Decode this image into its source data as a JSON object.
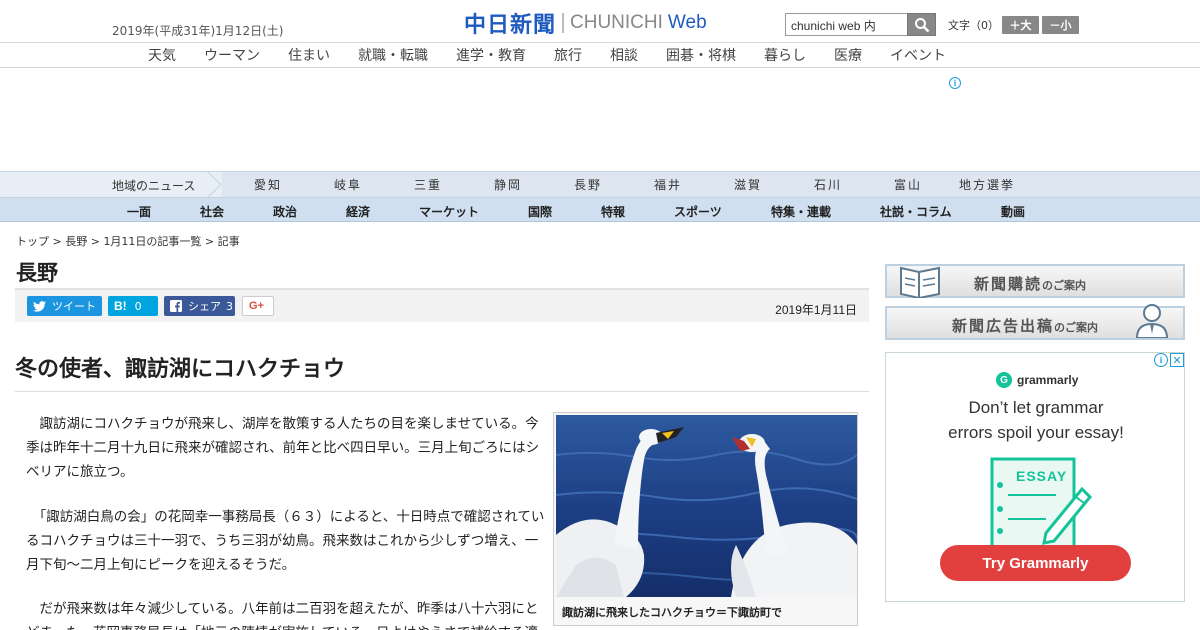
{
  "header": {
    "date": "2019年(平成31年)1月12日(土)",
    "logo_kanji": "中日新聞",
    "logo_en": "CHUNICHI",
    "logo_web": "Web",
    "search_value": "chunichi web 内",
    "fontsize_label": "文字（0）",
    "font_larger": "＋大",
    "font_smaller": "－小"
  },
  "top_nav": [
    "天気",
    "ウーマン",
    "住まい",
    "就職・転職",
    "進学・教育",
    "旅行",
    "相談",
    "囲碁・将棋",
    "暮らし",
    "医療",
    "イベント"
  ],
  "regional": {
    "title": "地域のニュース",
    "items": [
      "愛知",
      "岐阜",
      "三重",
      "静岡",
      "長野",
      "福井",
      "滋賀",
      "石川",
      "富山",
      "地方選挙"
    ]
  },
  "main_nav": [
    "一面",
    "社会",
    "政治",
    "経済",
    "マーケット",
    "国際",
    "特報",
    "スポーツ",
    "特集・連載",
    "社説・コラム",
    "動画"
  ],
  "breadcrumb": {
    "top": "トップ",
    "region": "長野",
    "list": "1月11日の記事一覧",
    "current": "記事",
    "sep": " > "
  },
  "section_title": "長野",
  "share": {
    "tweet": "ツイート",
    "hatena_count": "0",
    "facebook_label": "シェア",
    "facebook_count": "3",
    "gplus": "G+"
  },
  "article": {
    "date": "2019年1月11日",
    "headline": "冬の使者、諏訪湖にコハクチョウ",
    "paragraphs": [
      "　諏訪湖にコハクチョウが飛来し、湖岸を散策する人たちの目を楽しませている。今季は昨年十二月十九日に飛来が確認され、前年と比べ四日早い。三月上旬ごろにはシベリアに旅立つ。",
      "　「諏訪湖白鳥の会」の花岡幸一事務局長（６３）によると、十日時点で確認されているコハクチョウは三十一羽で、うち三羽が幼鳥。飛来数はこれから少しずつ増え、一月下旬～二月上旬にピークを迎えるそうだ。",
      "　だが飛来数は年々減少している。八年前は二百羽を超えたが、昨季は八十六羽にとどまった。花岡事務局長は「地元の陳情が実施している、日よけやえさで補給する適"
    ],
    "photo_caption": "諏訪湖に飛来したコハクチョウ＝下諏訪町で"
  },
  "sidebar": {
    "subscribe_main": "新聞購読",
    "subscribe_sub": "のご案内",
    "ad_main": "新聞広告出稿",
    "ad_sub": "のご案内"
  },
  "grammarly_ad": {
    "brand": "grammarly",
    "text_line1": "Don’t let grammar",
    "text_line2": "errors spoil your essay!",
    "essay_label": "ESSAY",
    "cta": "Try Grammarly"
  },
  "colors": {
    "brand_blue": "#1f5bbf",
    "twitter": "#1b95e0",
    "hatena": "#00a4de",
    "facebook": "#3b5998",
    "gplus": "#dd4b39",
    "grammarly_green": "#15c39a",
    "grammarly_red": "#e2403f"
  }
}
